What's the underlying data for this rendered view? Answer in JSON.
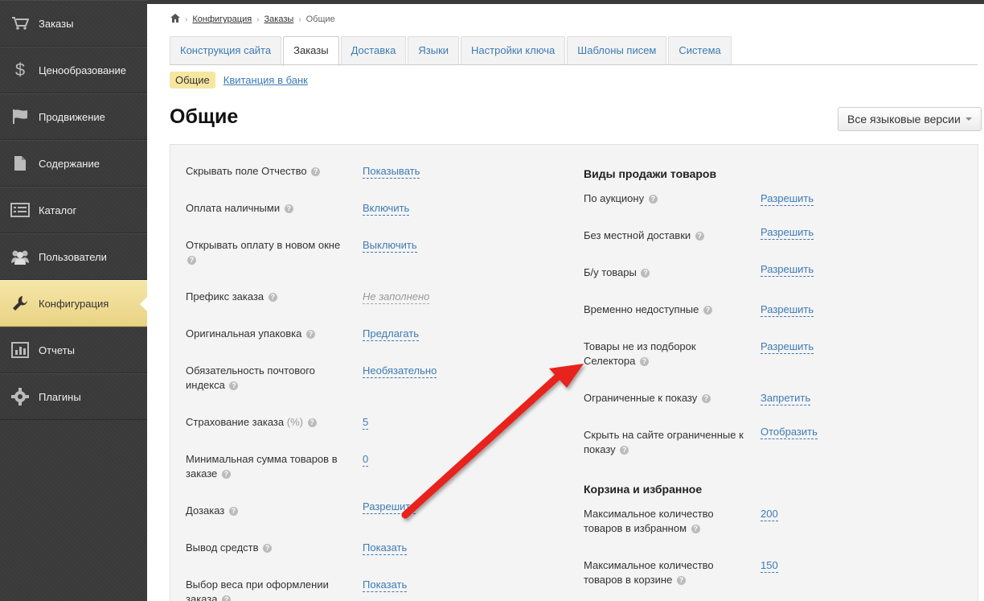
{
  "sidebar": {
    "items": [
      {
        "label": "Заказы",
        "icon": "cart-icon"
      },
      {
        "label": "Ценообразование",
        "icon": "dollar-icon"
      },
      {
        "label": "Продвижение",
        "icon": "flag-icon"
      },
      {
        "label": "Содержание",
        "icon": "document-icon"
      },
      {
        "label": "Каталог",
        "icon": "list-icon"
      },
      {
        "label": "Пользователи",
        "icon": "users-icon"
      },
      {
        "label": "Конфигурация",
        "icon": "wrench-icon",
        "active": true
      },
      {
        "label": "Отчеты",
        "icon": "bar-chart-icon"
      },
      {
        "label": "Плагины",
        "icon": "gear-icon"
      }
    ]
  },
  "breadcrumb": {
    "home_icon": "home-icon",
    "items": [
      "Конфигурация",
      "Заказы",
      "Общие"
    ]
  },
  "tabs": [
    "Конструкция сайта",
    "Заказы",
    "Доставка",
    "Языки",
    "Настройки ключа",
    "Шаблоны писем",
    "Система"
  ],
  "active_tab": "Заказы",
  "subnav": {
    "active": "Общие",
    "link": "Квитанция в банк"
  },
  "page_title": "Общие",
  "language_button": "Все языковые версии",
  "left_settings": [
    {
      "label": "Скрывать поле Отчество",
      "value": "Показывать"
    },
    {
      "label": "Оплата наличными",
      "value": "Включить"
    },
    {
      "label": "Открывать оплату в новом окне",
      "value": "Выключить"
    },
    {
      "label": "Префикс заказа",
      "value": "Не заполнено",
      "empty": true
    },
    {
      "label": "Оригинальная упаковка",
      "value": "Предлагать"
    },
    {
      "label": "Обязательность почтового индекса",
      "value": "Необязательно"
    },
    {
      "label": "Страхование заказа",
      "label_suffix": "(%)",
      "value": "5"
    },
    {
      "label": "Минимальная сумма товаров в заказе",
      "value": "0"
    },
    {
      "label": "Дозаказ",
      "value": "Разрешить"
    },
    {
      "label": "Вывод средств",
      "value": "Показать"
    },
    {
      "label": "Выбор веса при оформлении заказа",
      "value": "Показать"
    }
  ],
  "sales_section": {
    "title": "Виды продажи товаров",
    "settings": [
      {
        "label": "По аукциону",
        "value": "Разрешить"
      },
      {
        "label": "Без местной доставки",
        "value": "Разрешить"
      },
      {
        "label": "Б/у товары",
        "value": "Разрешить"
      },
      {
        "label": "Временно недоступные",
        "value": "Разрешить"
      },
      {
        "label": "Товары не из подборок Селектора",
        "value": "Разрешить"
      },
      {
        "label": "Ограниченные к показу",
        "value": "Запретить"
      },
      {
        "label": "Скрыть на сайте ограниченные к показу",
        "value": "Отобразить"
      }
    ]
  },
  "cart_section": {
    "title": "Корзина и избранное",
    "settings": [
      {
        "label": "Максимальное количество товаров в избранном",
        "value": "200"
      },
      {
        "label": "Максимальное количество товаров в корзине",
        "value": "150"
      }
    ]
  },
  "help_glyph": "?",
  "colors": {
    "link": "#3d7bb5",
    "active_highlight": "#f6e6a0",
    "arrow": "#e8221b",
    "sidebar": "#3a3a3a"
  }
}
